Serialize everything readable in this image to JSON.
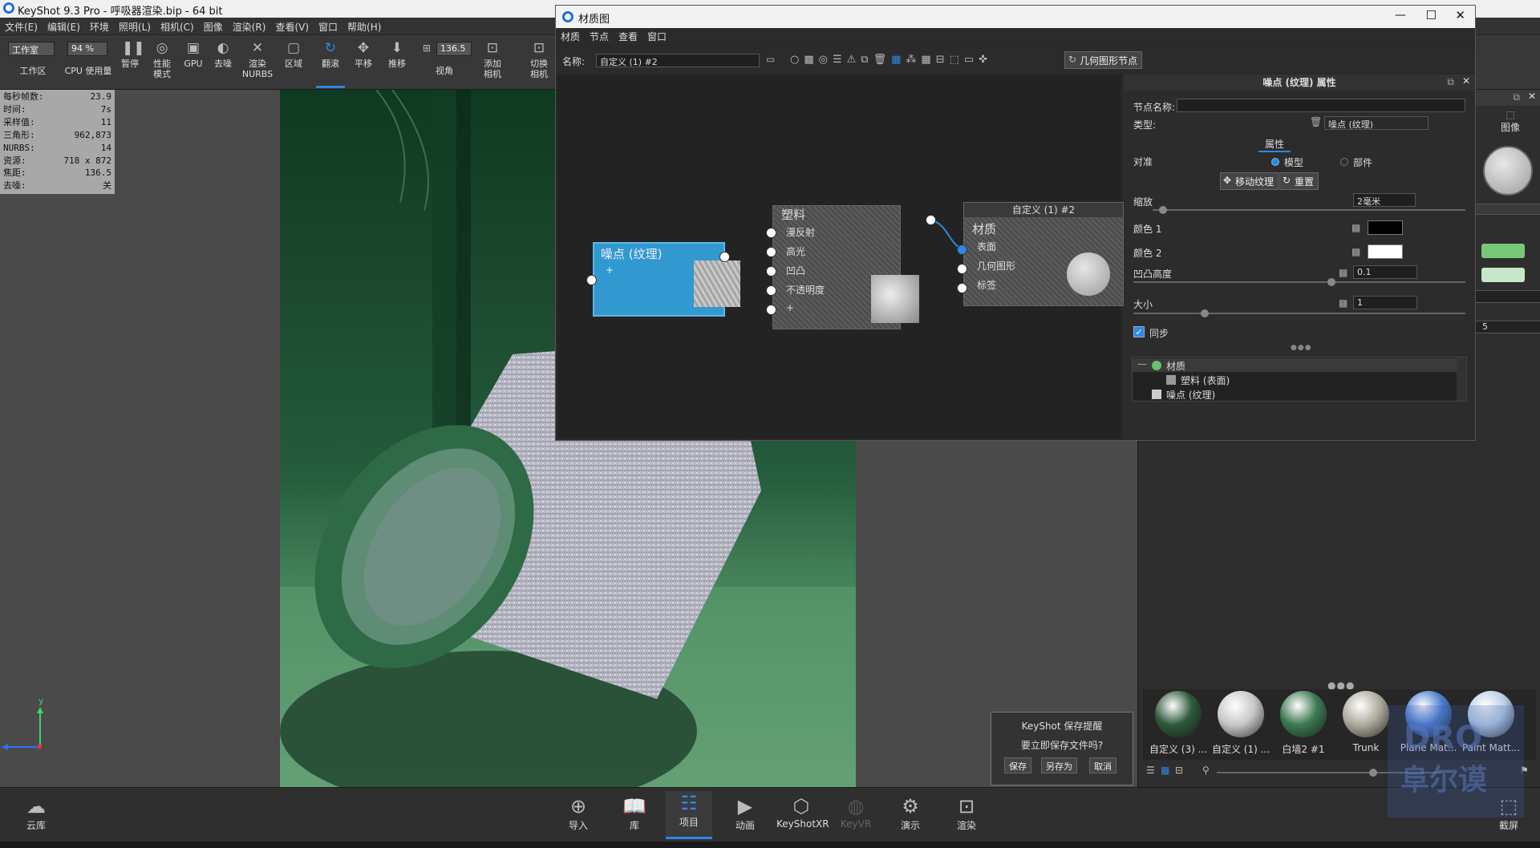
{
  "app": {
    "title": "KeyShot 9.3 Pro  - 呼吸器渲染.bip  - 64 bit"
  },
  "menu": [
    "文件(E)",
    "编辑(E)",
    "环境",
    "照明(L)",
    "相机(C)",
    "图像",
    "渲染(R)",
    "查看(V)",
    "窗口",
    "帮助(H)"
  ],
  "toolbar": {
    "workspace_value": "工作室",
    "workspace_label": "工作区",
    "cpu_value": "94 %",
    "cpu_label": "CPU 使用量",
    "pause": "暂停",
    "perf1": "性能",
    "perf2": "模式",
    "gpu": "GPU",
    "denoise": "去噪",
    "nurbs1": "渲染",
    "nurbs2": "NURBS",
    "region": "区域",
    "tumble": "翻滚",
    "pan": "平移",
    "dolly": "推移",
    "fov_value": "136.5",
    "fov_label": "视角",
    "addcam1": "添加",
    "addcam2": "相机",
    "switch1": "切换",
    "switch2": "相机"
  },
  "stats": [
    {
      "k": "每秒帧数:",
      "v": "23.9"
    },
    {
      "k": "时间:",
      "v": "7s"
    },
    {
      "k": "采样值:",
      "v": "11"
    },
    {
      "k": "三角形:",
      "v": "962,873"
    },
    {
      "k": "NURBS:",
      "v": "14"
    },
    {
      "k": "资源:",
      "v": "718 x 872"
    },
    {
      "k": "焦距:",
      "v": "136.5"
    },
    {
      "k": "去噪:",
      "v": "关"
    }
  ],
  "axis": {
    "y": "y"
  },
  "matgraph": {
    "title": "材质图",
    "menu": [
      "材质",
      "节点",
      "查看",
      "窗口"
    ],
    "name_label": "名称:",
    "name_value": "自定义 (1) #2",
    "geom_node_button": "几何图形节点",
    "noise_node": {
      "title": "噪点 (纹理)",
      "plus": "+"
    },
    "plastic_node": {
      "title": "塑料",
      "ports": [
        "漫反射",
        "高光",
        "凹凸",
        "不透明度",
        "+"
      ]
    },
    "material_node": {
      "header": "自定义 (1) #2",
      "title": "材质",
      "ports": [
        "表面",
        "几何图形",
        "标签"
      ]
    }
  },
  "props": {
    "title": "噪点 (纹理) 属性",
    "node_name_label": "节点名称:",
    "node_name_value": "",
    "type_label": "类型:",
    "type_value": "噪点 (纹理)",
    "tab": "属性",
    "align_label": "对准",
    "opt_model": "模型",
    "opt_part": "部件",
    "move_texture": "移动纹理",
    "reset": "重置",
    "scale_label": "缩放",
    "scale_value": "2毫米",
    "color1_label": "颜色 1",
    "color2_label": "颜色 2",
    "bump_label": "凹凸高度",
    "bump_value": "0.1",
    "size_label": "大小",
    "size_value": "1",
    "sync_label": "同步",
    "tree": [
      "材质",
      "塑料 (表面)",
      "噪点 (纹理)"
    ],
    "colors": {
      "color1": "#000000",
      "color2": "#ffffff"
    }
  },
  "rightpanel": {
    "image_label": "图像",
    "value1": "5",
    "swatch1": "#78c878",
    "swatch2": "#c8e6c8"
  },
  "library": [
    {
      "label": "自定义 (3) ...",
      "color": "#2f5a3c"
    },
    {
      "label": "自定义 (1) ...",
      "color": "#c8c8c8"
    },
    {
      "label": "白墙2 #1",
      "color": "#3c7a52"
    },
    {
      "label": "Trunk",
      "color": "#b0aba0"
    },
    {
      "label": "Plane Mat...",
      "color": "#4a7fd0"
    },
    {
      "label": "Paint Matt...",
      "color": "#b8cfe8"
    }
  ],
  "dialog": {
    "title": "KeyShot 保存提醒",
    "message": "要立即保存文件吗?",
    "save": "保存",
    "saveas": "另存为",
    "cancel": "取消"
  },
  "bottom": {
    "cloud": "云库",
    "import": "导入",
    "library": "库",
    "project": "项目",
    "animation": "动画",
    "keyshotxr": "KeyShotXR",
    "keyvr": "KeyVR",
    "present": "演示",
    "render": "渲染",
    "screenshot": "截屏"
  },
  "watermark": {
    "line1": "DRO",
    "line2": "阜尔谟"
  }
}
